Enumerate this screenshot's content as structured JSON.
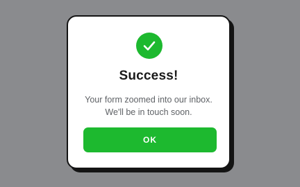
{
  "modal": {
    "icon": "checkmark-icon",
    "title": "Success!",
    "message_line1": "Your form zoomed into our inbox.",
    "message_line2": "We'll be in touch soon.",
    "button_label": "OK"
  },
  "colors": {
    "backdrop": "#8a8b8e",
    "accent": "#1db92f",
    "border": "#141414",
    "title": "#1a1a1a",
    "message": "#5f6266"
  }
}
